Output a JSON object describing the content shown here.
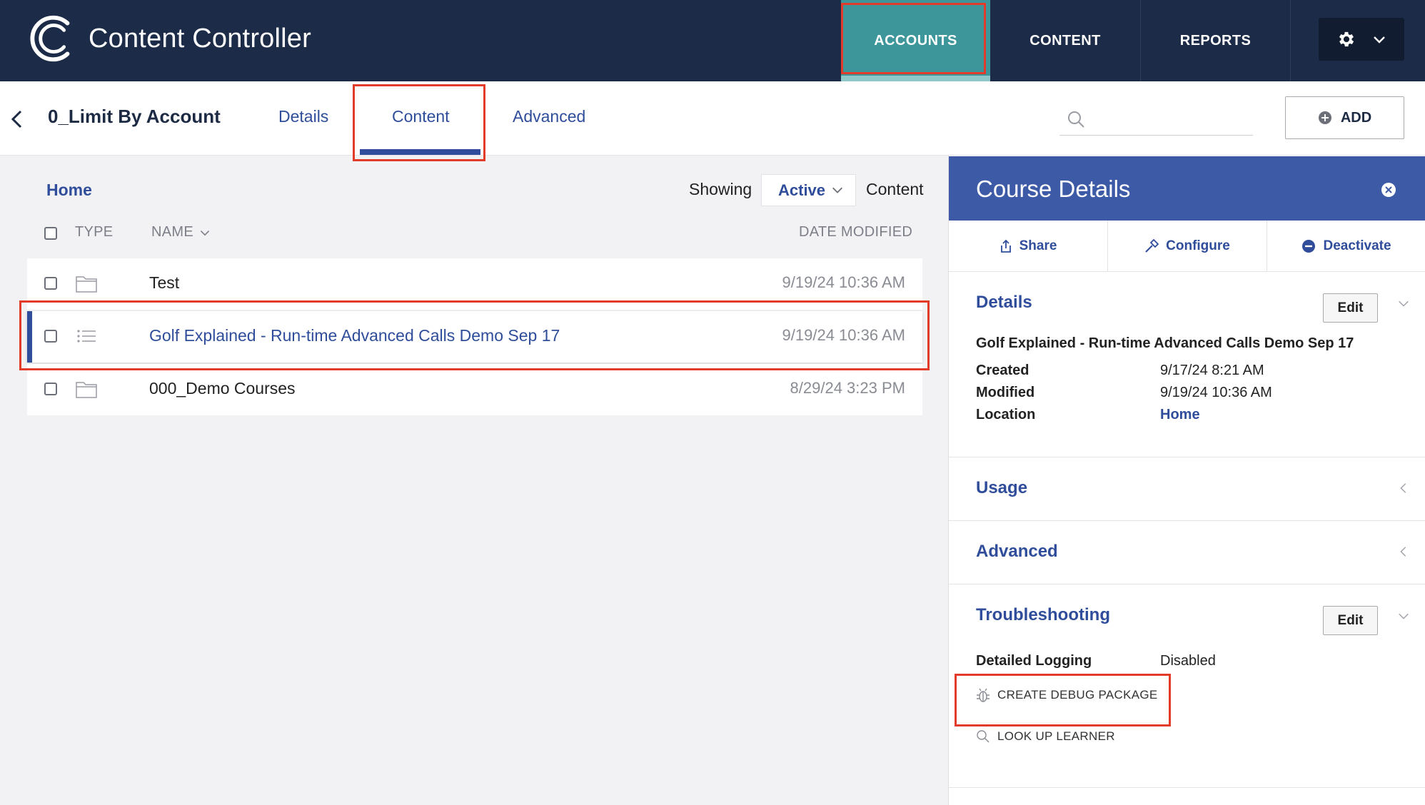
{
  "app": {
    "name": "Content Controller"
  },
  "nav": {
    "accounts": "ACCOUNTS",
    "content": "CONTENT",
    "reports": "REPORTS"
  },
  "subheader": {
    "title": "0_Limit By Account",
    "tabs": {
      "details": "Details",
      "content": "Content",
      "advanced": "Advanced"
    },
    "search_placeholder": "",
    "add_label": "ADD"
  },
  "list": {
    "breadcrumb": "Home",
    "showing_label": "Showing",
    "filter_value": "Active",
    "content_label": "Content",
    "columns": {
      "type": "TYPE",
      "name": "NAME",
      "date": "DATE MODIFIED"
    },
    "rows": [
      {
        "type": "folder",
        "name": "Test",
        "date": "9/19/24 10:36 AM"
      },
      {
        "type": "course",
        "name": "Golf Explained - Run-time Advanced Calls Demo Sep 17",
        "date": "9/19/24 10:36 AM"
      },
      {
        "type": "folder",
        "name": "000_Demo Courses",
        "date": "8/29/24 3:23 PM"
      }
    ]
  },
  "panel": {
    "title": "Course Details",
    "actions": {
      "share": "Share",
      "configure": "Configure",
      "deactivate": "Deactivate"
    },
    "details": {
      "title": "Details",
      "edit": "Edit",
      "course_name": "Golf Explained - Run-time Advanced Calls Demo Sep 17",
      "created_label": "Created",
      "created_value": "9/17/24 8:21 AM",
      "modified_label": "Modified",
      "modified_value": "9/19/24 10:36 AM",
      "location_label": "Location",
      "location_value": "Home"
    },
    "usage": {
      "title": "Usage"
    },
    "advanced": {
      "title": "Advanced"
    },
    "troubleshooting": {
      "title": "Troubleshooting",
      "edit": "Edit",
      "logging_label": "Detailed Logging",
      "logging_value": "Disabled",
      "debug_label": "CREATE DEBUG PACKAGE",
      "lookup_label": "LOOK UP LEARNER"
    }
  },
  "colors": {
    "topbar": "#1c2b47",
    "accent_teal": "#3d969a",
    "link_blue": "#2f4d9a",
    "panel_header": "#3c5aa6",
    "highlight_red": "#e23b2a"
  },
  "icons": [
    "logo-mark",
    "gear-icon",
    "chevron-down-icon",
    "back-icon",
    "search-icon",
    "add-circle-icon",
    "folder-icon",
    "list-icon",
    "close-circle-icon",
    "share-icon",
    "hammer-icon",
    "minus-circle-icon",
    "bug-icon",
    "magnifier-icon"
  ]
}
